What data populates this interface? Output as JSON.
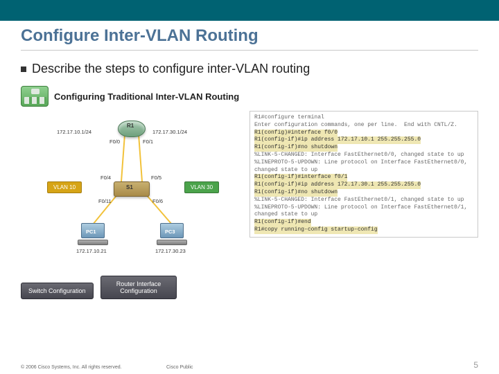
{
  "topbar": {},
  "title": "Configure Inter-VLAN Routing",
  "bullet_text": "Describe the steps to configure inter-VLAN routing",
  "subheader": "Configuring Traditional Inter-VLAN Routing",
  "diagram": {
    "router_name": "R1",
    "switch_name": "S1",
    "ip_left": "172.17.10.1/24",
    "ip_right": "172.17.30.1/24",
    "r_port_left": "F0/0",
    "r_port_right": "F0/1",
    "s_port_tl": "F0/4",
    "s_port_tr": "F0/5",
    "s_port_bl": "F0/11",
    "s_port_br": "F0/6",
    "vlan10": "VLAN 10",
    "vlan30": "VLAN 30",
    "pc1_name": "PC1",
    "pc3_name": "PC3",
    "pc1_ip": "172.17.10.21",
    "pc3_ip": "172.17.30.23"
  },
  "buttons": {
    "switch_cfg": "Switch Configuration",
    "router_cfg": "Router Interface Configuration"
  },
  "terminal": {
    "l1": "R1#configure terminal",
    "l2": "Enter configuration commands, one per line.  End with CNTL/Z.",
    "l3": "R1(config)#interface f0/0",
    "l4": "R1(config-if)#ip address 172.17.10.1 255.255.255.0",
    "l5": "R1(config-if)#no shutdown",
    "l6": "%LINK-5-CHANGED: Interface FastEthernet0/0, changed state to up",
    "l7": "%LINEPROTO-5-UPDOWN: Line protocol on Interface FastEthernet0/0, changed state to up",
    "l8": "R1(config-if)#interface f0/1",
    "l9": "R1(config-if)#ip address 172.17.30.1 255.255.255.0",
    "l10": "R1(config-if)#no shutdown",
    "l11": "%LINK-5-CHANGED: Interface FastEthernet0/1, changed state to up",
    "l12": "%LINEPROTO-5-UPDOWN: Line protocol on Interface FastEthernet0/1, changed state to up",
    "l13": "R1(config-if)#end",
    "l14": "R1#copy running-config startup-config"
  },
  "footer": {
    "copyright": "© 2006 Cisco Systems, Inc. All rights reserved.",
    "center": "Cisco Public",
    "page": "5"
  }
}
